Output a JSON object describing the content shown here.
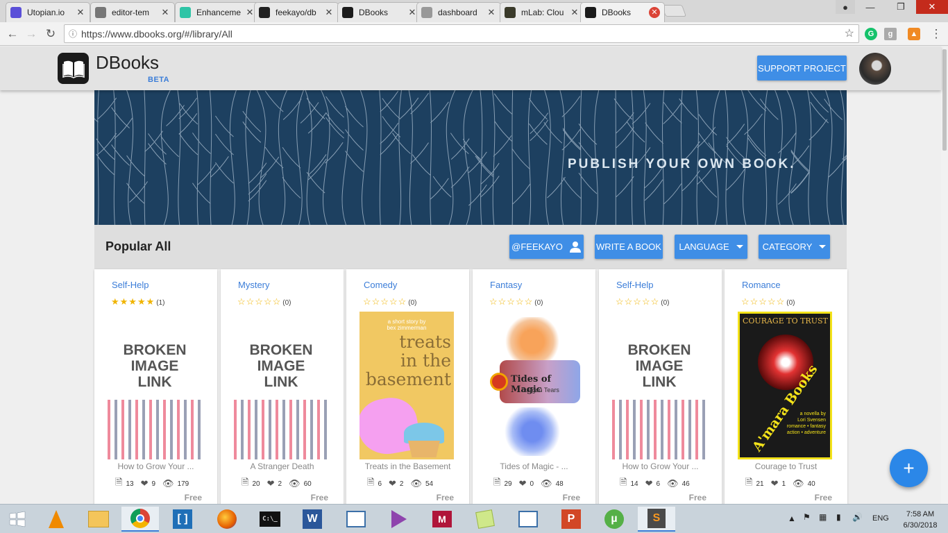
{
  "browser": {
    "tabs": [
      {
        "title": "Utopian.io",
        "icon_color": "#5a4fd8",
        "icon": "eye-icon"
      },
      {
        "title": "editor-tem",
        "icon_color": "#777777",
        "icon": "page-icon"
      },
      {
        "title": "Enhanceme",
        "icon_color": "#2ec4a6",
        "icon": "swirl-icon"
      },
      {
        "title": "feekayo/db",
        "icon_color": "#222222",
        "icon": "github-icon"
      },
      {
        "title": "DBooks",
        "icon_color": "#1b1b1b",
        "icon": "book-icon"
      },
      {
        "title": "dashboard",
        "icon_color": "#999999",
        "icon": "h-icon"
      },
      {
        "title": "mLab: Clou",
        "icon_color": "#3a3a2a",
        "icon": "db-icon"
      },
      {
        "title": "DBooks",
        "icon_color": "#1b1b1b",
        "icon": "book-icon"
      }
    ],
    "url": "https://www.dbooks.org/#/library/All"
  },
  "header": {
    "app_name": "DBooks",
    "badge": "BETA",
    "support_label": "SUPPORT PROJECT"
  },
  "banner": {
    "text": "PUBLISH YOUR OWN BOOK."
  },
  "section": {
    "title": "Popular All",
    "user_button": "@FEEKAYO",
    "write_button": "WRITE A BOOK",
    "language_button": "LANGUAGE",
    "category_button": "CATEGORY"
  },
  "books": [
    {
      "category": "Self-Help",
      "stars": "★★★★★",
      "rating_count": "(1)",
      "cover": "broken",
      "cover_text": [
        "BROKEN",
        "IMAGE",
        "LINK"
      ],
      "title": "How to Grow Your ...",
      "pages": "13",
      "likes": "9",
      "views": "179",
      "price": "Free",
      "filled": true
    },
    {
      "category": "Mystery",
      "stars": "☆☆☆☆☆",
      "rating_count": "(0)",
      "cover": "broken",
      "cover_text": [
        "BROKEN",
        "IMAGE",
        "LINK"
      ],
      "title": "A Stranger Death",
      "pages": "20",
      "likes": "2",
      "views": "60",
      "price": "Free",
      "filled": false
    },
    {
      "category": "Comedy",
      "stars": "☆☆☆☆☆",
      "rating_count": "(0)",
      "cover": "treats",
      "cover_text": [
        "a short story by",
        "bex zimmerman",
        "treats",
        "in the",
        "basement"
      ],
      "title": "Treats in the Basement",
      "pages": "6",
      "likes": "2",
      "views": "54",
      "price": "Free",
      "filled": false
    },
    {
      "category": "Fantasy",
      "stars": "☆☆☆☆☆",
      "rating_count": "(0)",
      "cover": "tides",
      "cover_text": [
        "Tides of Magic",
        "Dragon Tears"
      ],
      "title": "Tides of Magic - ...",
      "pages": "29",
      "likes": "0",
      "views": "48",
      "price": "Free",
      "filled": false
    },
    {
      "category": "Self-Help",
      "stars": "☆☆☆☆☆",
      "rating_count": "(0)",
      "cover": "broken",
      "cover_text": [
        "BROKEN",
        "IMAGE",
        "LINK"
      ],
      "title": "How to Grow Your ...",
      "pages": "14",
      "likes": "6",
      "views": "46",
      "price": "Free",
      "filled": false
    },
    {
      "category": "Romance",
      "stars": "☆☆☆☆☆",
      "rating_count": "(0)",
      "cover": "courage",
      "cover_text": [
        "COURAGE TO TRUST",
        "A'mara Books",
        "a novella by",
        "Lori Svensen",
        "romance • fantasy",
        "action • adventure"
      ],
      "title": "Courage to Trust",
      "pages": "21",
      "likes": "1",
      "views": "40",
      "price": "Free",
      "filled": false
    }
  ],
  "fab": {
    "label": "+"
  },
  "taskbar": {
    "language": "ENG",
    "time": "7:58 AM",
    "date": "6/30/2018"
  }
}
